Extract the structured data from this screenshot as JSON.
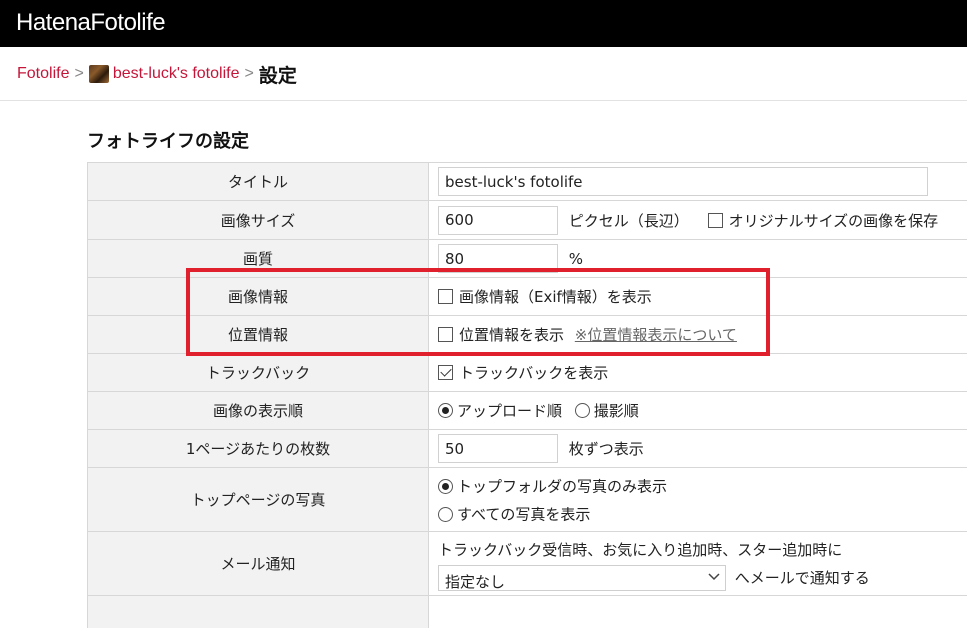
{
  "header": {
    "logo": "HatenaFotolife"
  },
  "breadcrumb": {
    "root": "Fotolife",
    "sep1": ">",
    "user": "best-luck's fotolife",
    "sep2": ">",
    "current": "設定"
  },
  "section": {
    "title": "フォトライフの設定"
  },
  "rows": {
    "title": {
      "label": "タイトル",
      "value": "best-luck's fotolife"
    },
    "image_size": {
      "label": "画像サイズ",
      "value": "600",
      "unit": "ピクセル（長辺）",
      "checkbox_label": "オリジナルサイズの画像を保存",
      "checked": false
    },
    "quality": {
      "label": "画質",
      "value": "80",
      "unit": "%"
    },
    "image_info": {
      "label": "画像情報",
      "checkbox_label": "画像情報（Exif情報）を表示",
      "checked": false
    },
    "location": {
      "label": "位置情報",
      "checkbox_label": "位置情報を表示",
      "link": "※位置情報表示について",
      "checked": false
    },
    "trackback": {
      "label": "トラックバック",
      "checkbox_label": "トラックバックを表示",
      "checked": true
    },
    "order": {
      "label": "画像の表示順",
      "option1": "アップロード順",
      "option2": "撮影順",
      "selected": "アップロード順"
    },
    "per_page": {
      "label": "1ページあたりの枚数",
      "value": "50",
      "unit": "枚ずつ表示"
    },
    "top_photo": {
      "label": "トップページの写真",
      "option1": "トップフォルダの写真のみ表示",
      "option2": "すべての写真を表示",
      "selected": "トップフォルダの写真のみ表示"
    },
    "mail": {
      "label": "メール通知",
      "description": "トラックバック受信時、お気に入り追加時、スター追加時に",
      "select_value": "指定なし",
      "suffix": "へメールで通知する"
    }
  },
  "colors": {
    "accent": "#c5163a",
    "highlight": "#e0202c",
    "header_bg": "#000000"
  }
}
